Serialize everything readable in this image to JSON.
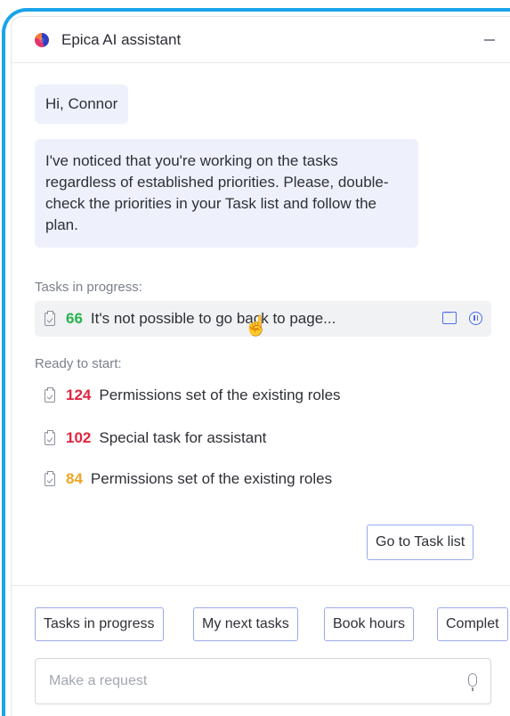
{
  "header": {
    "title": "Epica AI assistant"
  },
  "messages": [
    "Hi, Connor",
    "I've noticed that you're working on the tasks regardless of established priorities. Please, double-check the priorities in your Task list and follow the plan."
  ],
  "in_progress": {
    "label": "Tasks in progress:",
    "tasks": [
      {
        "number": "66",
        "color": "#27b24a",
        "title": "It's not possible to go back to page..."
      }
    ]
  },
  "ready": {
    "label": "Ready to start:",
    "tasks": [
      {
        "number": "124",
        "color": "#e2243f",
        "title": "Permissions set of the existing roles"
      },
      {
        "number": "102",
        "color": "#e2243f",
        "title": "Special task for assistant"
      },
      {
        "number": "84",
        "color": "#f0a523",
        "title": "Permissions set of the existing roles"
      }
    ]
  },
  "go_to_task_list": "Go to Task list",
  "quick_actions": [
    "Tasks in progress",
    "My next tasks",
    "Book hours",
    "Complet"
  ],
  "request": {
    "placeholder": "Make a request"
  }
}
